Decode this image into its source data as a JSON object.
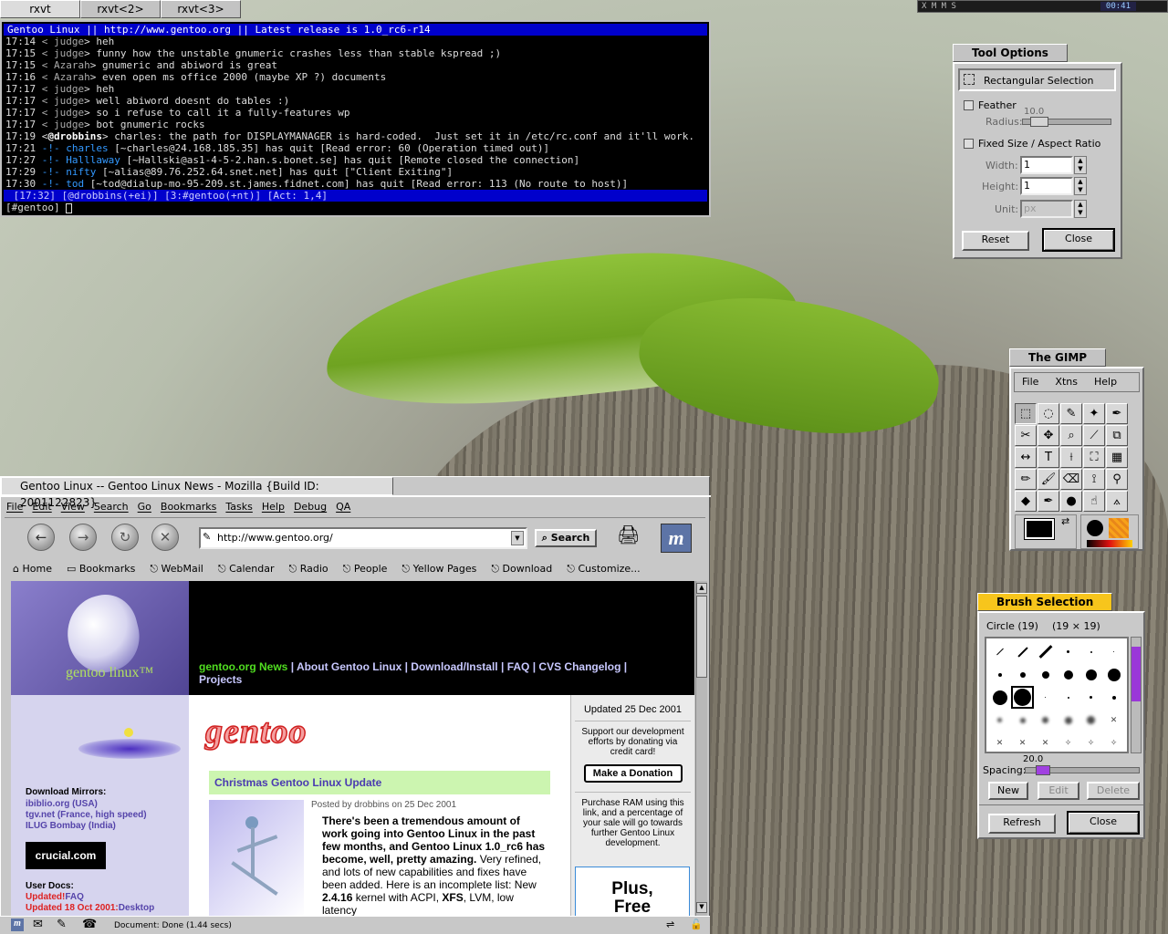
{
  "taskbar": {
    "tabs": [
      "rxvt",
      "rxvt<2>",
      "rxvt<3>"
    ],
    "pager_label": "X M M S",
    "clock": "00:41"
  },
  "terminal": {
    "topic": "Gentoo Linux || http://www.gentoo.org || Latest release is 1.0_rc6-r14",
    "lines": [
      {
        "time": "17:14",
        "nick": "judge",
        "text": "heh",
        "kind": "msg"
      },
      {
        "time": "17:15",
        "nick": "judge",
        "text": "funny how the unstable gnumeric crashes less than stable kspread ;)",
        "kind": "msg"
      },
      {
        "time": "17:15",
        "nick": "Azarah",
        "text": "gnumeric and abiword is great",
        "kind": "msg"
      },
      {
        "time": "17:16",
        "nick": "Azarah",
        "text": "even open ms office 2000 (maybe XP ?) documents",
        "kind": "msg"
      },
      {
        "time": "17:17",
        "nick": "judge",
        "text": "heh",
        "kind": "msg"
      },
      {
        "time": "17:17",
        "nick": "judge",
        "text": "well abiword doesnt do tables :)",
        "kind": "msg"
      },
      {
        "time": "17:17",
        "nick": "judge",
        "text": "so i refuse to call it a fully-features wp",
        "kind": "msg"
      },
      {
        "time": "17:17",
        "nick": "judge",
        "text": "bot gnumeric rocks",
        "kind": "msg"
      },
      {
        "time": "17:19",
        "nick": "@drobbins",
        "text": "charles: the path for DISPLAYMANAGER is hard-coded.  Just set it in /etc/rc.conf and it'll work.",
        "kind": "op"
      },
      {
        "time": "17:21",
        "nick": "charles",
        "text": "[~charles@24.168.185.35] has quit [Read error: 60 (Operation timed out)]",
        "kind": "quit"
      },
      {
        "time": "17:27",
        "nick": "Halllaway",
        "text": "[~Hallski@as1-4-5-2.han.s.bonet.se] has quit [Remote closed the connection]",
        "kind": "quit"
      },
      {
        "time": "17:29",
        "nick": "nifty",
        "text": "[~alias@89.76.252.64.snet.net] has quit [\"Client Exiting\"]",
        "kind": "quit"
      },
      {
        "time": "17:30",
        "nick": "tod",
        "text": "[~tod@dialup-mo-95-209.st.james.fidnet.com] has quit [Read error: 113 (No route to host)]",
        "kind": "quit"
      }
    ],
    "status": " [17:32] [@drobbins(+ei)] [3:#gentoo(+nt)] [Act: 1,4]",
    "prompt": "[#gentoo] "
  },
  "tool_options": {
    "title": "Tool Options",
    "tool_name": "Rectangular Selection",
    "feather_label": "Feather",
    "radius_label": "Radius:",
    "radius_value": "10.0",
    "radius_fraction": 0.1,
    "fixed_size_label": "Fixed Size / Aspect Ratio",
    "width_label": "Width:",
    "width_value": "1",
    "height_label": "Height:",
    "height_value": "1",
    "unit_label": "Unit:",
    "unit_value": "px",
    "reset_label": "Reset",
    "close_label": "Close"
  },
  "gimp": {
    "title": "The GIMP",
    "menu": [
      "File",
      "Xtns",
      "Help"
    ],
    "tools": [
      {
        "name": "rect-select-tool",
        "glyph": "⬚"
      },
      {
        "name": "ellipse-select-tool",
        "glyph": "◌"
      },
      {
        "name": "free-select-tool",
        "glyph": "✎"
      },
      {
        "name": "fuzzy-select-tool",
        "glyph": "✦"
      },
      {
        "name": "bezier-select-tool",
        "glyph": "✒"
      },
      {
        "name": "scissors-tool",
        "glyph": "✂"
      },
      {
        "name": "move-tool",
        "glyph": "✥"
      },
      {
        "name": "magnify-tool",
        "glyph": "⌕"
      },
      {
        "name": "crop-tool",
        "glyph": "⟋"
      },
      {
        "name": "transform-tool",
        "glyph": "⧉"
      },
      {
        "name": "flip-tool",
        "glyph": "↔"
      },
      {
        "name": "text-tool",
        "glyph": "T"
      },
      {
        "name": "color-picker-tool",
        "glyph": "⟊"
      },
      {
        "name": "bucket-fill-tool",
        "glyph": "⛶"
      },
      {
        "name": "blend-tool",
        "glyph": "▦"
      },
      {
        "name": "pencil-tool",
        "glyph": "✏"
      },
      {
        "name": "paintbrush-tool",
        "glyph": "🖌"
      },
      {
        "name": "eraser-tool",
        "glyph": "⌫"
      },
      {
        "name": "airbrush-tool",
        "glyph": "⟟"
      },
      {
        "name": "clone-tool",
        "glyph": "⚲"
      },
      {
        "name": "convolve-tool",
        "glyph": "◆"
      },
      {
        "name": "ink-tool",
        "glyph": "✒"
      },
      {
        "name": "dodge-burn-tool",
        "glyph": "●"
      },
      {
        "name": "smudge-tool",
        "glyph": "☝"
      },
      {
        "name": "measure-tool",
        "glyph": "⟑"
      }
    ],
    "fg_color": "#000000",
    "bg_color": "#ffffff"
  },
  "brush_selection": {
    "title": "Brush Selection",
    "brush_name": "Circle (19)",
    "brush_size": "(19 × 19)",
    "spacing_label": "Spacing:",
    "spacing_value": "20.0",
    "spacing_fraction": 0.1,
    "new_label": "New",
    "edit_label": "Edit",
    "delete_label": "Delete",
    "refresh_label": "Refresh",
    "close_label": "Close"
  },
  "mozilla": {
    "title": "Gentoo Linux -- Gentoo Linux News - Mozilla {Build ID: 2001122823}",
    "menu": [
      "File",
      "Edit",
      "View",
      "Search",
      "Go",
      "Bookmarks",
      "Tasks",
      "Help",
      "Debug",
      "QA"
    ],
    "url": "http://www.gentoo.org/",
    "search_label": "Search",
    "personal_toolbar": [
      "Home",
      "Bookmarks",
      "WebMail",
      "Calendar",
      "Radio",
      "People",
      "Yellow Pages",
      "Download",
      "Customize..."
    ],
    "status": "Document: Done (1.44 secs)"
  },
  "page": {
    "logo_text": "gentoo linux™",
    "nav": {
      "item1": "gentoo.org News",
      "item2": "About Gentoo Linux",
      "item3": "Download/Install",
      "item4": "FAQ",
      "item5": "CVS Changelog",
      "item6": "Projects",
      "sep": "|"
    },
    "wordmark": "gentoo",
    "headline": "Christmas Gentoo Linux Update",
    "posted": "Posted by drobbins on 25 Dec 2001",
    "article_bold": "There's been a tremendous amount of work going into Gentoo Linux in the past few months, and Gentoo Linux 1.0_rc6 has become, well, pretty amazing.",
    "article_text": " Very refined, and lots of new capabilities and fixes have been added. Here is an incomplete list: New ",
    "article_bold2": "2.4.16",
    "article_text2": " kernel with ACPI, ",
    "article_bold3": "XFS",
    "article_text3": ", LVM, low latency",
    "mirrors_title": "Download Mirrors:",
    "mirrors": [
      "ibiblio.org (USA)",
      "tgv.net (France, high speed)",
      "ILUG Bombay (India)"
    ],
    "sponsor": "crucial.com",
    "userdocs_title": "User Docs:",
    "userdocs_updated1_prefix": "Updated!",
    "userdocs_updated1_link": "FAQ",
    "userdocs_updated2_prefix": "Updated 18 Oct 2001:",
    "userdocs_updated2_link": "Desktop",
    "updated": "Updated 25 Dec 2001",
    "support_text": "Support our development efforts by donating via credit card!",
    "donate_label": "Make a Donation",
    "ram_text": "Purchase RAM using this link, and a percentage of your sale will go towards further Gentoo Linux development.",
    "ad_line1": "Plus,",
    "ad_line2": "Free"
  }
}
